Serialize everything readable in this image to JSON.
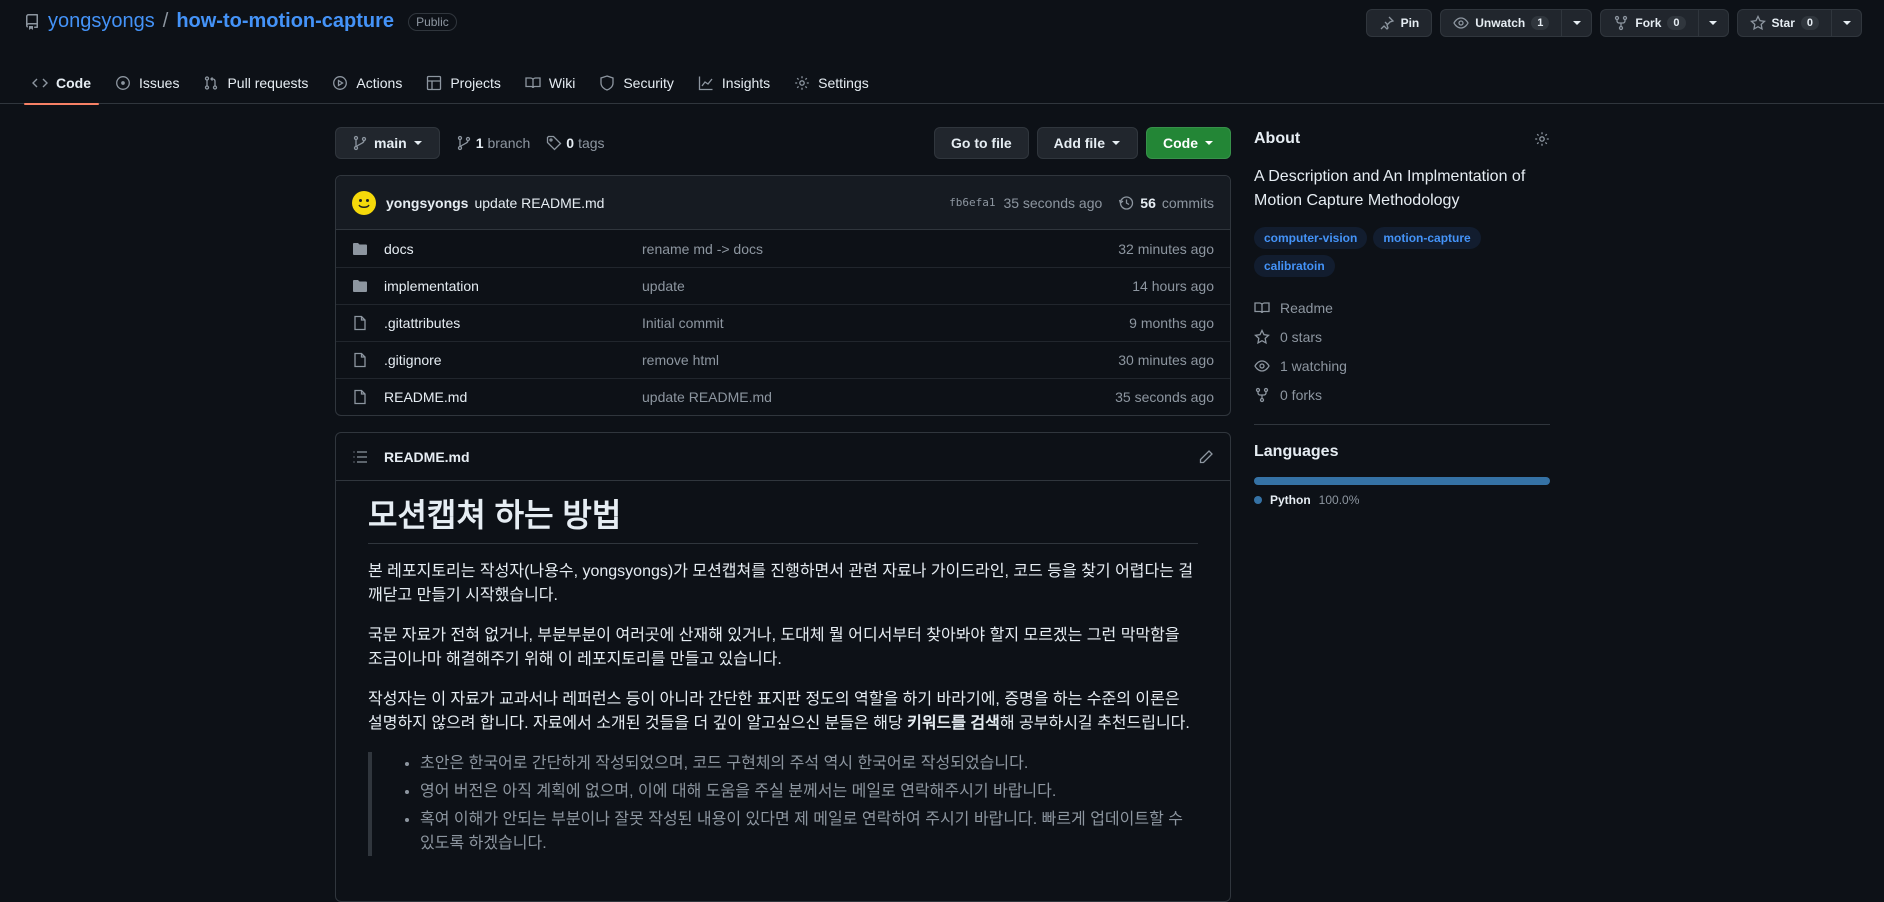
{
  "repo": {
    "owner": "yongsyongs",
    "separator": "/",
    "name": "how-to-motion-capture",
    "visibility": "Public"
  },
  "header_actions": {
    "pin": "Pin",
    "unwatch": "Unwatch",
    "watch_count": "1",
    "fork": "Fork",
    "fork_count": "0",
    "star": "Star",
    "star_count": "0"
  },
  "tabs": [
    {
      "label": "Code",
      "icon": "code-icon",
      "active": true
    },
    {
      "label": "Issues",
      "icon": "issue-icon"
    },
    {
      "label": "Pull requests",
      "icon": "pull-request-icon"
    },
    {
      "label": "Actions",
      "icon": "play-icon"
    },
    {
      "label": "Projects",
      "icon": "table-icon"
    },
    {
      "label": "Wiki",
      "icon": "book-icon"
    },
    {
      "label": "Security",
      "icon": "shield-icon"
    },
    {
      "label": "Insights",
      "icon": "graph-icon"
    },
    {
      "label": "Settings",
      "icon": "gear-icon"
    }
  ],
  "toolbar": {
    "branch": "main",
    "branch_count": "1",
    "branch_label": "branch",
    "tag_count": "0",
    "tag_label": "tags",
    "go_to_file": "Go to file",
    "add_file": "Add file",
    "code": "Code"
  },
  "latest_commit": {
    "author": "yongsyongs",
    "message": "update README.md",
    "sha": "fb6efa1",
    "time": "35 seconds ago",
    "commit_count": "56",
    "commit_label": "commits"
  },
  "files": [
    {
      "type": "dir",
      "name": "docs",
      "message": "rename md -> docs",
      "time": "32 minutes ago"
    },
    {
      "type": "dir",
      "name": "implementation",
      "message": "update",
      "time": "14 hours ago"
    },
    {
      "type": "file",
      "name": ".gitattributes",
      "message": "Initial commit",
      "time": "9 months ago"
    },
    {
      "type": "file",
      "name": ".gitignore",
      "message": "remove html",
      "time": "30 minutes ago"
    },
    {
      "type": "file",
      "name": "README.md",
      "message": "update README.md",
      "time": "35 seconds ago"
    }
  ],
  "readme": {
    "filename": "README.md",
    "title": "모션캡쳐 하는 방법",
    "p1": "본 레포지토리는 작성자(나용수, yongsyongs)가 모션캡쳐를 진행하면서 관련 자료나 가이드라인, 코드 등을 찾기 어렵다는 걸 깨닫고 만들기 시작했습니다.",
    "p2": "국문 자료가 전혀 없거나, 부분부분이 여러곳에 산재해 있거나, 도대체 뭘 어디서부터 찾아봐야 할지 모르겠는 그런 막막함을 조금이나마 해결해주기 위해 이 레포지토리를 만들고 있습니다.",
    "p3_before": "작성자는 이 자료가 교과서나 레퍼런스 등이 아니라 간단한 표지판 정도의 역할을 하기 바라기에, 증명을 하는 수준의 이론은 설명하지 않으려 합니다. 자료에서 소개된 것들을 더 깊이 알고싶으신 분들은 해당 ",
    "p3_bold": "키워드를 검색",
    "p3_after": "해 공부하시길 추천드립니다.",
    "notes": [
      "초안은 한국어로 간단하게 작성되었으며, 코드 구현체의 주석 역시 한국어로 작성되었습니다.",
      "영어 버전은 아직 계획에 없으며, 이에 대해 도움을 주실 분께서는 메일로 연락해주시기 바랍니다.",
      "혹여 이해가 안되는 부분이나 잘못 작성된 내용이 있다면 제 메일로 연락하여 주시기 바랍니다. 빠르게 업데이트할 수 있도록 하겠습니다."
    ]
  },
  "about": {
    "heading": "About",
    "description": "A Description and An Implmentation of Motion Capture Methodology",
    "topics": [
      "computer-vision",
      "motion-capture",
      "calibratoin"
    ],
    "readme": "Readme",
    "stars": "0 stars",
    "watching": "1 watching",
    "forks": "0 forks"
  },
  "languages": {
    "heading": "Languages",
    "items": [
      {
        "name": "Python",
        "percent": "100.0%",
        "color": "#3572a5"
      }
    ]
  }
}
